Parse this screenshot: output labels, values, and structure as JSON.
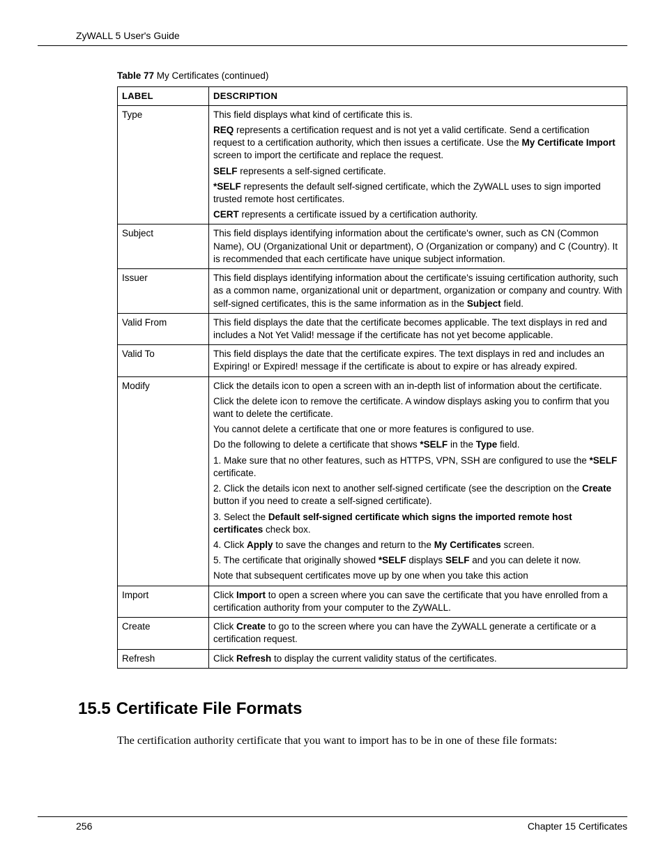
{
  "header": {
    "title": "ZyWALL 5 User's Guide"
  },
  "table": {
    "caption_prefix": "Table 77",
    "caption_rest": "  My Certificates (continued)",
    "headers": {
      "label": "LABEL",
      "description": "DESCRIPTION"
    },
    "rows": {
      "type": {
        "label": "Type",
        "p1": "This field displays what kind of certificate this is.",
        "p2a": "REQ",
        "p2b": " represents a certification request and is not yet a valid certificate. Send a certification request to a certification authority, which then issues a certificate. Use the ",
        "p2c": "My Certificate Import",
        "p2d": " screen to import the certificate and replace the request.",
        "p3a": "SELF",
        "p3b": " represents a self-signed certificate.",
        "p4a": "*SELF",
        "p4b": " represents the default self-signed certificate, which the ZyWALL uses to sign imported trusted remote host certificates.",
        "p5a": "CERT",
        "p5b": " represents a certificate issued by a certification authority."
      },
      "subject": {
        "label": "Subject",
        "p1": "This field displays identifying information about the certificate's owner, such as CN (Common Name), OU (Organizational Unit or department), O (Organization or company) and C (Country). It is recommended that each certificate have unique subject information."
      },
      "issuer": {
        "label": "Issuer",
        "p1a": "This field displays identifying information about the certificate's issuing certification authority, such as a common name, organizational unit or department, organization or company and country. With self-signed certificates, this is the same information as in the ",
        "p1b": "Subject",
        "p1c": " field."
      },
      "validfrom": {
        "label": "Valid From",
        "p1": "This field displays the date that the certificate becomes applicable. The text displays in red and includes a Not Yet Valid! message if the certificate has not yet become applicable."
      },
      "validto": {
        "label": "Valid To",
        "p1": "This field displays the date that the certificate expires. The text displays in red and includes an Expiring! or Expired! message if the certificate is about to expire or has already expired."
      },
      "modify": {
        "label": "Modify",
        "p1": "Click the details icon to open a screen with an in-depth list of information about the certificate.",
        "p2": "Click the delete icon to remove the certificate. A window displays asking you to confirm that you want to delete the certificate.",
        "p3": "You cannot delete a certificate that one or more features is configured to use.",
        "p4a": "Do the following to delete a certificate that shows ",
        "p4b": "*SELF",
        "p4c": " in the ",
        "p4d": "Type",
        "p4e": " field.",
        "p5a": "1. Make sure that no other features, such as HTTPS, VPN, SSH  are configured to use the ",
        "p5b": "*SELF",
        "p5c": " certificate.",
        "p6a": "2.  Click the details icon next to another self-signed certificate (see the description on the ",
        "p6b": "Create",
        "p6c": " button if you need to create a self-signed certificate).",
        "p7a": "3.  Select the ",
        "p7b": "Default self-signed certificate which signs the imported remote host certificates",
        "p7c": " check box.",
        "p8a": "4.  Click ",
        "p8b": "Apply",
        "p8c": " to save the changes and return to the ",
        "p8d": "My Certificates",
        "p8e": " screen.",
        "p9a": "5.  The certificate that originally showed ",
        "p9b": "*SELF",
        "p9c": " displays ",
        "p9d": "SELF",
        "p9e": " and you can delete it now.",
        "p10": "Note that subsequent certificates move up by one when you take this action"
      },
      "import": {
        "label": "Import",
        "p1a": "Click ",
        "p1b": "Import",
        "p1c": " to open a screen where you can save the certificate that you have enrolled from a certification authority from your computer to the ZyWALL."
      },
      "create": {
        "label": "Create",
        "p1a": "Click ",
        "p1b": "Create",
        "p1c": " to go to the screen where you can have the ZyWALL generate a certificate or a certification request."
      },
      "refresh": {
        "label": "Refresh",
        "p1a": "Click ",
        "p1b": "Refresh",
        "p1c": " to display the current validity status of the certificates."
      }
    }
  },
  "section": {
    "number": "15.5",
    "title": "Certificate File Formats",
    "body": "The certification authority certificate that you want to import has to be in one of these file formats:"
  },
  "footer": {
    "page": "256",
    "chapter": "Chapter 15 Certificates"
  }
}
